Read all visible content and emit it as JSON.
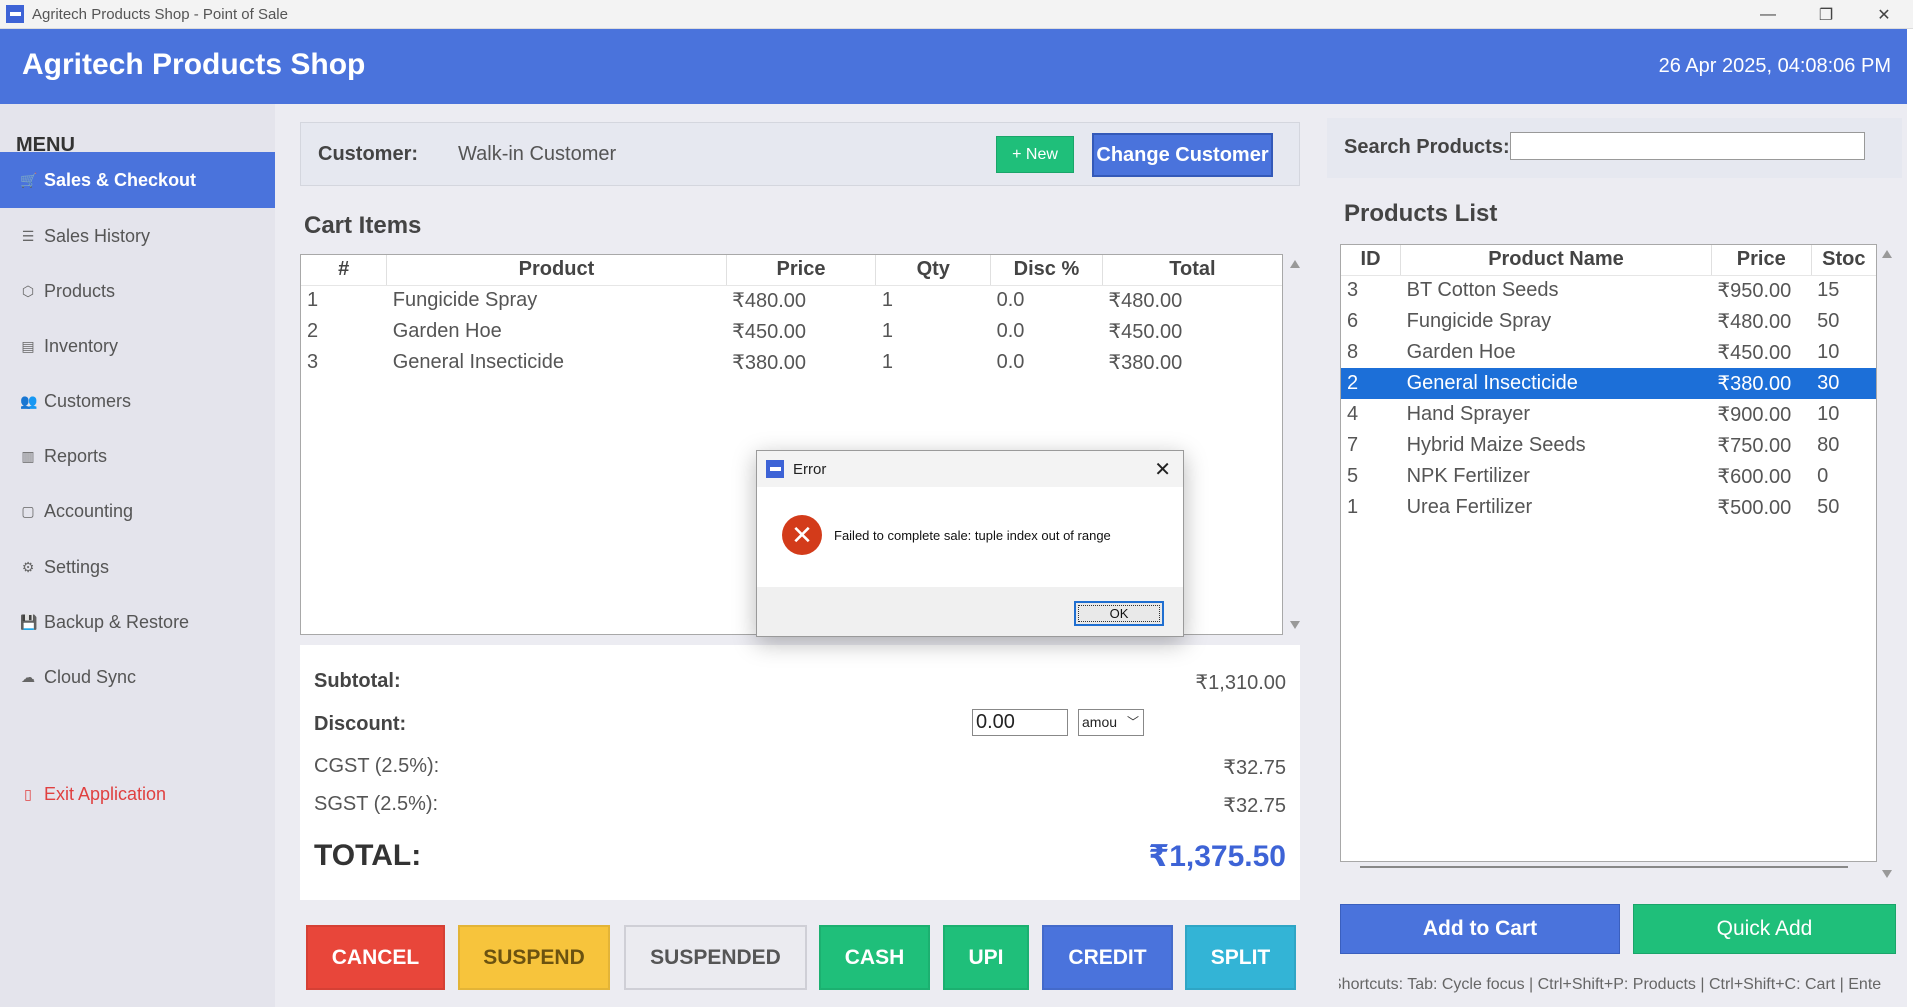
{
  "window": {
    "title": "Agritech Products Shop - Point of Sale",
    "minimize": "—",
    "maximize": "❐",
    "close": "✕"
  },
  "header": {
    "title": "Agritech Products Shop",
    "datetime": "26 Apr 2025, 04:08:06 PM"
  },
  "sidebar": {
    "menu_label": "MENU",
    "items": [
      {
        "label": "Sales & Checkout",
        "icon": "cart-icon",
        "glyph": "🛒"
      },
      {
        "label": "Sales History",
        "icon": "receipt-icon",
        "glyph": "☰"
      },
      {
        "label": "Products",
        "icon": "package-icon",
        "glyph": "⬡"
      },
      {
        "label": "Inventory",
        "icon": "clipboard-icon",
        "glyph": "▤"
      },
      {
        "label": "Customers",
        "icon": "users-icon",
        "glyph": "👥"
      },
      {
        "label": "Reports",
        "icon": "chart-icon",
        "glyph": "▥"
      },
      {
        "label": "Accounting",
        "icon": "ledger-icon",
        "glyph": "▢"
      },
      {
        "label": "Settings",
        "icon": "gear-icon",
        "glyph": "⚙"
      },
      {
        "label": "Backup & Restore",
        "icon": "disk-icon",
        "glyph": "💾"
      },
      {
        "label": "Cloud Sync",
        "icon": "cloud-icon",
        "glyph": "☁"
      }
    ],
    "exit": {
      "label": "Exit Application",
      "icon": "exit-icon",
      "glyph": "▯"
    }
  },
  "customer": {
    "label": "Customer:",
    "value": "Walk-in Customer",
    "new_button": "+ New",
    "change_button": "Change Customer"
  },
  "cart": {
    "title": "Cart Items",
    "columns": [
      "#",
      "Product",
      "Price",
      "Qty",
      "Disc %",
      "Total"
    ],
    "rows": [
      [
        "1",
        "Fungicide Spray",
        "₹480.00",
        "1",
        "0.0",
        "₹480.00"
      ],
      [
        "2",
        "Garden Hoe",
        "₹450.00",
        "1",
        "0.0",
        "₹450.00"
      ],
      [
        "3",
        "General Insecticide",
        "₹380.00",
        "1",
        "0.0",
        "₹380.00"
      ]
    ]
  },
  "totals": {
    "subtotal_label": "Subtotal:",
    "subtotal": "₹1,310.00",
    "discount_label": "Discount:",
    "discount_value": "0.00",
    "discount_type": "amou",
    "cgst_label": "CGST (2.5%):",
    "cgst": "₹32.75",
    "sgst_label": "SGST (2.5%):",
    "sgst": "₹32.75",
    "total_label": "TOTAL:",
    "total": "₹1,375.50"
  },
  "actions": [
    {
      "label": "CANCEL",
      "color": "#e8463a"
    },
    {
      "label": "SUSPEND",
      "color": "#f7c43c"
    },
    {
      "label": "SUSPENDED",
      "color": "#ebebf0"
    },
    {
      "label": "CASH",
      "color": "#1fbf7a"
    },
    {
      "label": "UPI",
      "color": "#1fbf7a"
    },
    {
      "label": "CREDIT",
      "color": "#4a73dc"
    },
    {
      "label": "SPLIT",
      "color": "#33b4d6"
    }
  ],
  "products": {
    "search_label": "Search Products:",
    "search_value": "",
    "title": "Products List",
    "columns": [
      "ID",
      "Product Name",
      "Price",
      "Stoc"
    ],
    "rows": [
      [
        "3",
        "BT Cotton Seeds",
        "₹950.00",
        "15"
      ],
      [
        "6",
        "Fungicide Spray",
        "₹480.00",
        "50"
      ],
      [
        "8",
        "Garden Hoe",
        "₹450.00",
        "10"
      ],
      [
        "2",
        "General Insecticide",
        "₹380.00",
        "30"
      ],
      [
        "4",
        "Hand Sprayer",
        "₹900.00",
        "10"
      ],
      [
        "7",
        "Hybrid Maize Seeds",
        "₹750.00",
        "80"
      ],
      [
        "5",
        "NPK Fertilizer",
        "₹600.00",
        "0"
      ],
      [
        "1",
        "Urea Fertilizer",
        "₹500.00",
        "50"
      ]
    ],
    "selected_index": 3,
    "add_to_cart": "Add to Cart",
    "quick_add": "Quick Add",
    "shortcuts": "Shortcuts: Tab: Cycle focus | Ctrl+Shift+P: Products | Ctrl+Shift+C: Cart | Ente"
  },
  "dialog": {
    "title": "Error",
    "close": "✕",
    "message": "Failed to complete sale: tuple index out of range",
    "ok": "OK",
    "error_glyph": "✕"
  },
  "colors": {
    "accent": "#4a73dc",
    "success": "#1fbf7a",
    "danger": "#e8463a",
    "warning": "#f7c43c",
    "info": "#33b4d6",
    "selection": "#1c6fd8"
  }
}
